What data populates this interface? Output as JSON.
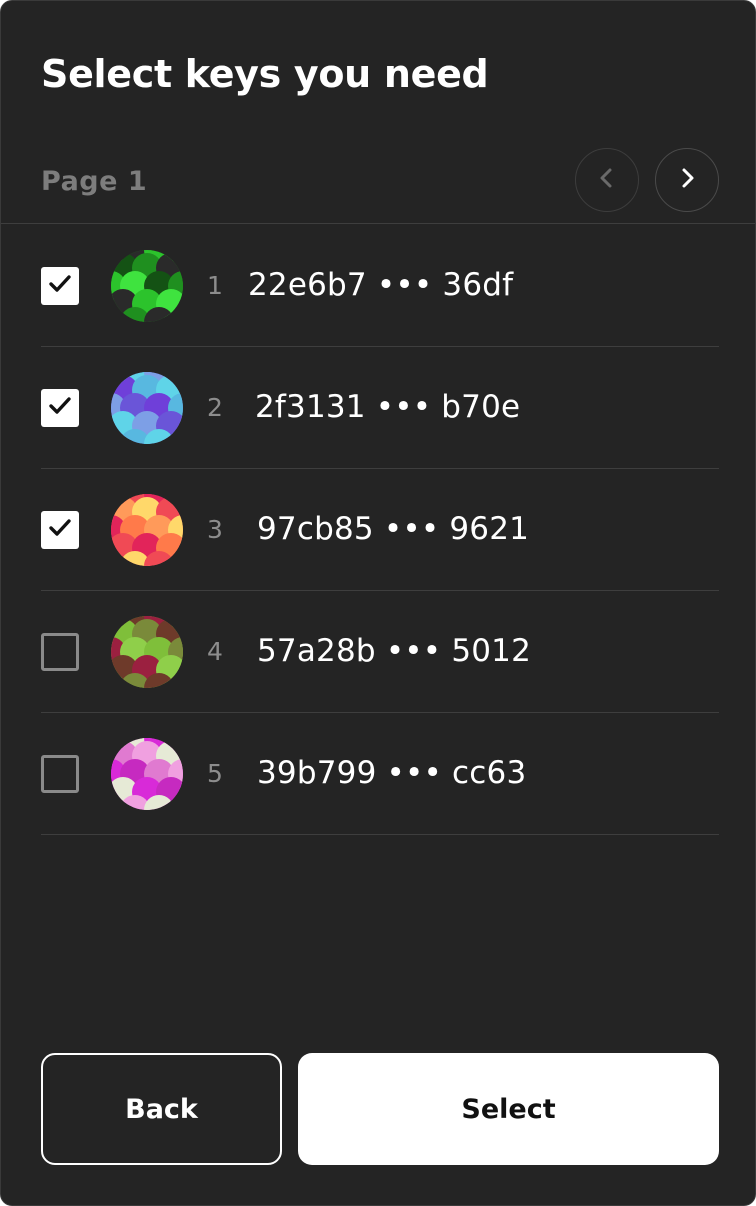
{
  "header": {
    "title": "Select keys you need",
    "page_label": "Page 1",
    "prev_icon": "chevron-left-icon",
    "next_icon": "chevron-right-icon"
  },
  "keys": [
    {
      "index": "1",
      "address": "22e6b7 ••• 36df",
      "checked": true,
      "palette": [
        "#1f8f1f",
        "#2cc32c",
        "#145214",
        "#2a2a2a",
        "#3fe33f"
      ]
    },
    {
      "index": "2",
      "address": "2f3131 ••• b70e",
      "checked": true,
      "palette": [
        "#6a55d8",
        "#58b8e0",
        "#7d9fe6",
        "#6f3fd9",
        "#5fd4e8"
      ]
    },
    {
      "index": "3",
      "address": "97cb85 ••• 9621",
      "checked": true,
      "palette": [
        "#f04a55",
        "#ff7a4a",
        "#ffd86a",
        "#e2245a",
        "#ff9a5a"
      ]
    },
    {
      "index": "4",
      "address": "57a28b ••• 5012",
      "checked": false,
      "palette": [
        "#7fbf3a",
        "#6e3a2a",
        "#8fcf4a",
        "#7a8a3a",
        "#9b2040"
      ]
    },
    {
      "index": "5",
      "address": "39b799 ••• cc63",
      "checked": false,
      "palette": [
        "#d82ad8",
        "#e07ad0",
        "#e6ead6",
        "#c62ac0",
        "#f0a0e0"
      ]
    }
  ],
  "footer": {
    "back_label": "Back",
    "select_label": "Select"
  },
  "colors": {
    "panel_bg": "#242424",
    "divider": "#3e3e3e",
    "muted_text": "#7d7d7d",
    "primary_button_bg": "#ffffff"
  }
}
